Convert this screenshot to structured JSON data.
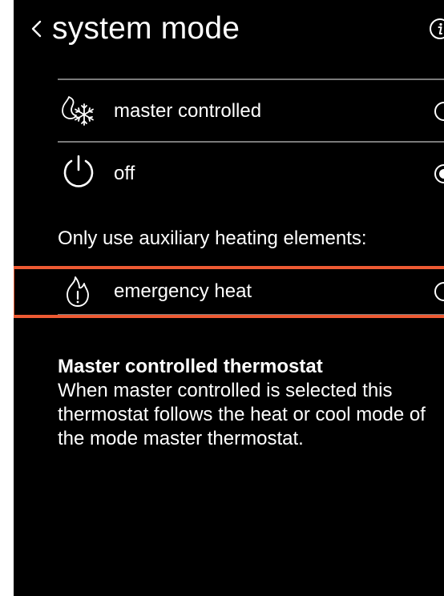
{
  "header": {
    "title": "system mode"
  },
  "options": [
    {
      "label": "master controlled",
      "selected": false,
      "icon": "flame-snowflake-icon"
    },
    {
      "label": "off",
      "selected": true,
      "icon": "power-icon"
    }
  ],
  "auxiliary": {
    "section_label": "Only use auxiliary heating elements:",
    "option": {
      "label": "emergency heat",
      "selected": false,
      "icon": "emergency-flame-icon"
    }
  },
  "description": {
    "title": "Master controlled thermostat",
    "body": "When master controlled is selected this thermostat follows the heat or cool mode of the mode master thermostat."
  },
  "colors": {
    "background": "#000000",
    "text": "#ffffff",
    "divider": "#7a7a7a",
    "highlight": "#ee5a33"
  }
}
